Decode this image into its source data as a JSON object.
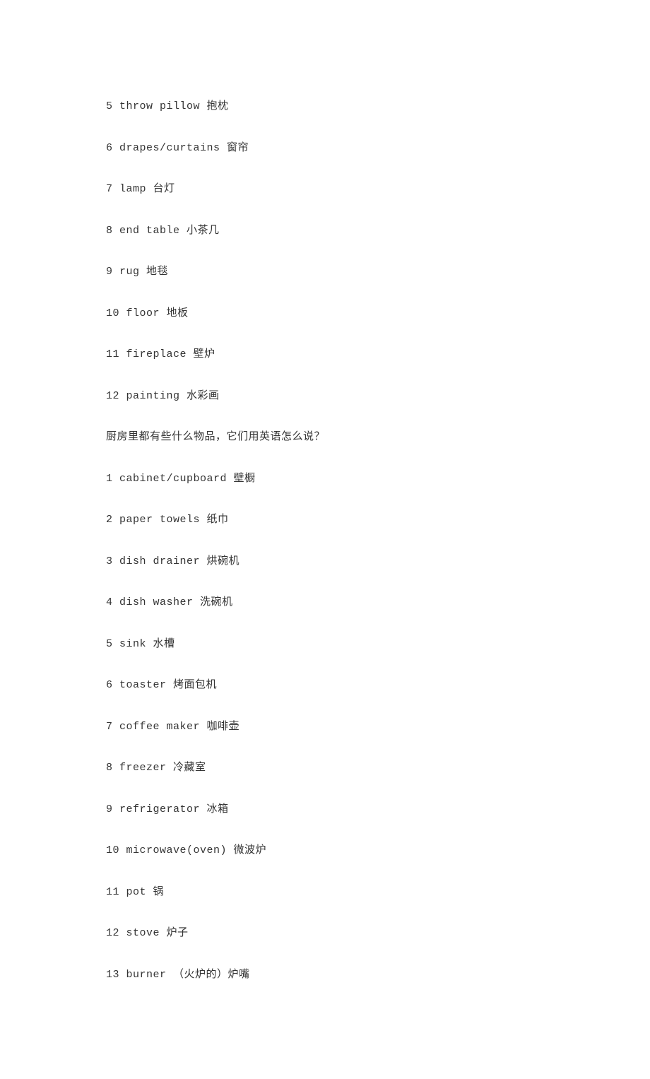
{
  "lines": [
    "5 throw pillow 抱枕",
    "6 drapes/curtains 窗帘",
    "7 lamp 台灯",
    "8 end table 小茶几",
    "9 rug 地毯",
    "10 floor 地板",
    "11 fireplace 壁炉",
    "12 painting 水彩画",
    "厨房里都有些什么物品，它们用英语怎么说？",
    "1 cabinet/cupboard 壁橱",
    "2 paper towels 纸巾",
    "3 dish drainer 烘碗机",
    "4 dish washer 洗碗机",
    "5 sink 水槽",
    "6 toaster 烤面包机",
    "7 coffee maker 咖啡壶",
    "8 freezer 冷藏室",
    "9 refrigerator 冰箱",
    "10 microwave(oven) 微波炉",
    "11 pot 锅",
    "12 stove 炉子",
    "13 burner （火炉的）炉嘴"
  ]
}
